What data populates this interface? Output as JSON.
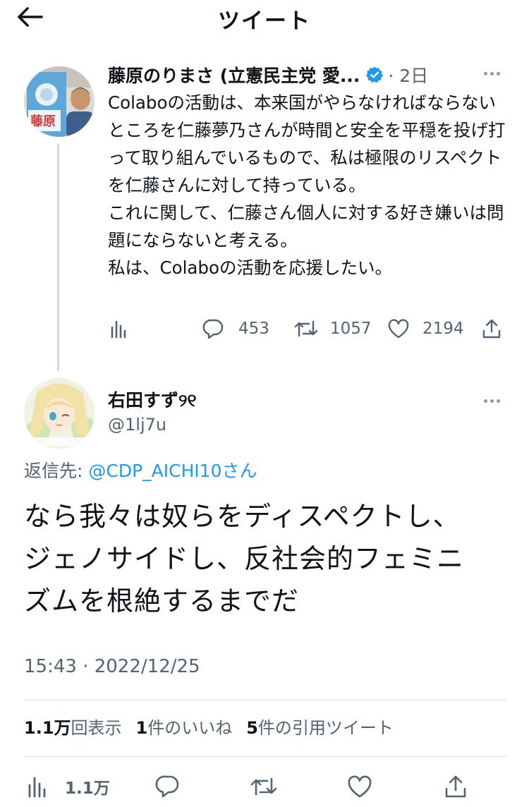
{
  "header": {
    "title": "ツイート",
    "back_icon": "arrow-left-icon"
  },
  "tweet1": {
    "author_name": "藤原のりまさ (立憲民主党 愛...",
    "verified_icon": "verified-badge-icon",
    "time": "· 2日",
    "text": "Colaboの活動は、本来国がやらなければならないところを仁藤夢乃さんが時間と安全を平穏を投げ打って取り組んでいるもので、私は極限のリスペクトを仁藤さんに対して持っている。\nこれに関して、仁藤さん個人に対する好き嫌いは問題にならないと考える。\n私は、Colaboの活動を応援したい。",
    "avatar_label": "藤原",
    "actions": {
      "analytics_icon": "analytics-icon",
      "reply_count": "453",
      "retweet_count": "1057",
      "like_count": "2194",
      "share_icon": "share-icon"
    }
  },
  "tweet2": {
    "author_name": "右田すず୨୧",
    "handle": "@1lj7u",
    "reply_to_label": "返信先: ",
    "reply_to_mention": "@CDP_AICHI10さん",
    "text": "なら我々は奴らをディスペクトし、\nジェノサイドし、反社会的フェミニ\nズムを根絶するまでだ",
    "timestamp": "15:43 · 2022/12/25",
    "stats": {
      "views_count": "1.1万",
      "views_label": "回表示",
      "likes_count": "1",
      "likes_label": "件のいいね",
      "quotes_count": "5",
      "quotes_label": "件の引用ツイート"
    },
    "bottom_bar": {
      "views": "1.1万"
    }
  },
  "colors": {
    "text_primary": "#0f1419",
    "text_secondary": "#536471",
    "accent": "#1d9bf0",
    "divider": "#d8dee2"
  }
}
